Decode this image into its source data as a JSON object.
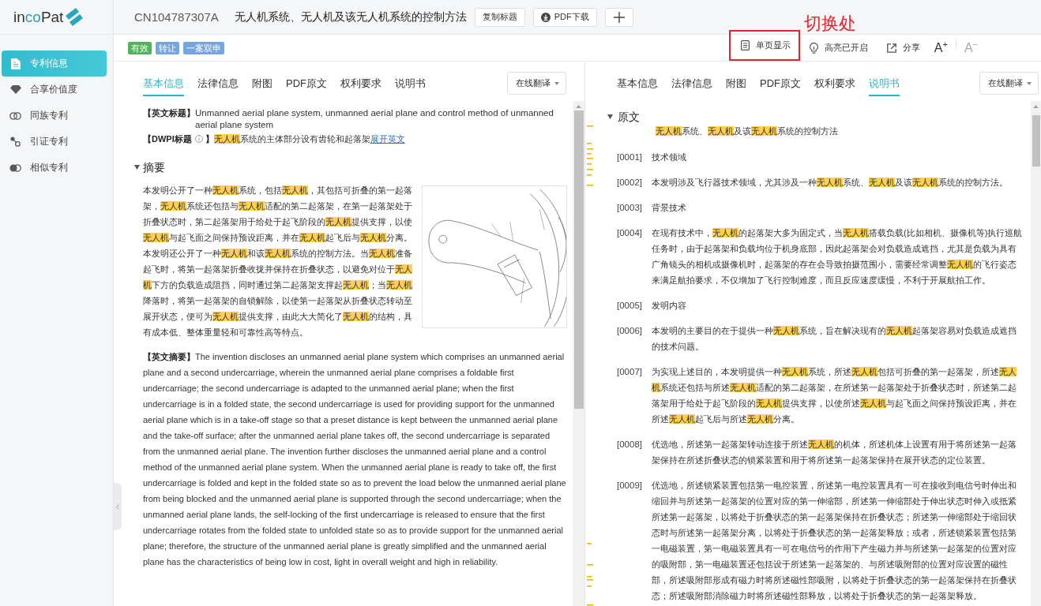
{
  "sidebar": {
    "logo": [
      {
        "text": "in",
        "accent": false
      },
      {
        "text": "co",
        "accent": true
      },
      {
        "text": "Pat",
        "accent": false
      }
    ],
    "items": [
      {
        "label": "专利信息",
        "selected": true
      },
      {
        "label": "合享价值度",
        "selected": false
      },
      {
        "label": "同族专利",
        "selected": false
      },
      {
        "label": "引证专利",
        "selected": false
      },
      {
        "label": "相似专利",
        "selected": false
      }
    ]
  },
  "header": {
    "patent_number": "CN104787307A",
    "title": "无人机系统、无人机及该无人机系统的控制方法",
    "buttons": [
      {
        "kind": "copy",
        "label": "复制标题"
      },
      {
        "kind": "download",
        "label": "PDF下载"
      },
      {
        "kind": "add"
      }
    ]
  },
  "tags": [
    {
      "label": "有效",
      "color": "#52b45a"
    },
    {
      "label": "转让",
      "color": "#76a5e0"
    },
    {
      "label": "一案双申",
      "color": "#76a5e0"
    }
  ],
  "toolbar": [
    {
      "kind": "single_page",
      "label": "单页显示",
      "annotated": true,
      "note": "切换处"
    },
    {
      "kind": "highlight",
      "label": "高亮已开启",
      "annotated": false
    },
    {
      "kind": "share",
      "label": "分享",
      "annotated": false
    },
    {
      "kind": "font_size",
      "label": "A$^{+}$",
      "disabled": false
    },
    {
      "kind": "font_size",
      "label": "A$^{−}$",
      "disabled": true
    }
  ],
  "left_panel": {
    "tabs": [
      {
        "label": "基本信息",
        "selected": true
      },
      {
        "label": "法律信息",
        "selected": false
      },
      {
        "label": "附图",
        "selected": false
      },
      {
        "label": "PDF原文",
        "selected": false
      },
      {
        "label": "权利要求",
        "selected": false
      },
      {
        "label": "说明书",
        "selected": false
      }
    ],
    "translate_button": "在线翻译",
    "english_title": {
      "label": "【英文标题】",
      "value": "Unmanned aerial plane system, unmanned aerial plane and control method of unmanned aerial plane system"
    },
    "dwpi_title": {
      "label": "【DWPI标题",
      "label_end": "】",
      "value": [
        {
          "text": "无人机",
          "highlight": true
        },
        {
          "text": "系统的主体部分设有齿轮和起落架",
          "highlight": false
        }
      ],
      "link": "展开英文"
    },
    "abstract": {
      "heading": "摘要",
      "expanded": true,
      "text": [
        {
          "text": "本发明公开了一种",
          "highlight": false
        },
        {
          "text": "无人机",
          "highlight": true
        },
        {
          "text": "系统，包括",
          "highlight": false
        },
        {
          "text": "无人机",
          "highlight": true
        },
        {
          "text": "，其包括可折叠的第一起落架，",
          "highlight": false
        },
        {
          "text": "无人机",
          "highlight": true
        },
        {
          "text": "系统还包括与",
          "highlight": false
        },
        {
          "text": "无人机",
          "highlight": true
        },
        {
          "text": "适配的第二起落架，在第一起落架处于折叠状态时，第二起落架用于给处于起飞阶段的",
          "highlight": false
        },
        {
          "text": "无人机",
          "highlight": true
        },
        {
          "text": "提供支撑，以使",
          "highlight": false
        },
        {
          "text": "无人机",
          "highlight": true
        },
        {
          "text": "与起飞面之间保持预设距离，并在",
          "highlight": false
        },
        {
          "text": "无人机",
          "highlight": true
        },
        {
          "text": "起飞后与",
          "highlight": false
        },
        {
          "text": "无人机",
          "highlight": true
        },
        {
          "text": "分离。本发明还公开了一种",
          "highlight": false
        },
        {
          "text": "无人机",
          "highlight": true
        },
        {
          "text": "和该",
          "highlight": false
        },
        {
          "text": "无人机",
          "highlight": true
        },
        {
          "text": "系统的控制方法。当",
          "highlight": false
        },
        {
          "text": "无人机",
          "highlight": true
        },
        {
          "text": "准备起飞时，将第一起落架折叠收拢并保持在折叠状态，以避免对位于",
          "highlight": false
        },
        {
          "text": "无人机",
          "highlight": true
        },
        {
          "text": "下方的负载造成阻挡，同时通过第二起落架支撑起",
          "highlight": false
        },
        {
          "text": "无人机",
          "highlight": true
        },
        {
          "text": "；当",
          "highlight": false
        },
        {
          "text": "无人机",
          "highlight": true
        },
        {
          "text": "降落时，将第一起落架的自锁解除，以使第一起落架从折叠状态转动至展开状态，便可为",
          "highlight": false
        },
        {
          "text": "无人机",
          "highlight": true
        },
        {
          "text": "提供支撑，由此大大简化了",
          "highlight": false
        },
        {
          "text": "无人机",
          "highlight": true
        },
        {
          "text": "的结构，具有成本低、整体重量轻和可靠性高等特点。",
          "highlight": false
        }
      ],
      "english_label": "【英文摘要】",
      "english_text": "The invention discloses an unmanned aerial plane system which comprises an unmanned aerial plane and a second undercarriage, wherein the unmanned aerial plane comprises a foldable first undercarriage; the second undercarriage is adapted to the unmanned aerial plane; when the first undercarriage is in a folded state, the second undercarriage is used for providing support for the unmanned aerial plane which is in a take-off stage so that a preset distance is kept between the unmanned aerial plane and the take-off surface; after the unmanned aerial plane takes off, the second undercarriage is separated from the unmanned aerial plane. The invention further discloses the unmanned aerial plane and a control method of the unmanned aerial plane system. When the unmanned aerial plane is ready to take off, the first undercarriage is folded and kept in the folded state so as to prevent the load below the unmanned aerial plane from being blocked and the unmanned aerial plane is supported through the second undercarriage; when the unmanned aerial plane lands, the self-locking of the first undercarriage is released to ensure that the first undercarriage rotates from the folded state to unfolded state so as to provide support for the unmanned aerial plane; therefore, the structure of the unmanned aerial plane is greatly simplified and the unmanned aerial plane has the characteristics of being low in cost, light in overall weight and high in reliability."
    }
  },
  "right_panel": {
    "tabs": [
      {
        "label": "基本信息",
        "selected": false
      },
      {
        "label": "法律信息",
        "selected": false
      },
      {
        "label": "附图",
        "selected": false
      },
      {
        "label": "PDF原文",
        "selected": false
      },
      {
        "label": "权利要求",
        "selected": false
      },
      {
        "label": "说明书",
        "selected": true
      }
    ],
    "translate_button": "在线翻译",
    "section": {
      "heading": "原文",
      "expanded": true,
      "title": [
        {
          "text": "无人机",
          "highlight": true
        },
        {
          "text": "系统、",
          "highlight": false
        },
        {
          "text": "无人机",
          "highlight": true
        },
        {
          "text": "及该",
          "highlight": false
        },
        {
          "text": "无人机",
          "highlight": true
        },
        {
          "text": "系统的控制方法",
          "highlight": false
        }
      ],
      "paragraphs": [
        {
          "number": "[0001]",
          "text": [
            {
              "text": "技术领域",
              "highlight": false
            }
          ]
        },
        {
          "number": "[0002]",
          "text": [
            {
              "text": "本发明涉及飞行器技术领域，尤其涉及一种",
              "highlight": false
            },
            {
              "text": "无人机",
              "highlight": true
            },
            {
              "text": "系统、",
              "highlight": false
            },
            {
              "text": "无人机",
              "highlight": true
            },
            {
              "text": "及该",
              "highlight": false
            },
            {
              "text": "无人机",
              "highlight": true
            },
            {
              "text": "系统的控制方法。",
              "highlight": false
            }
          ]
        },
        {
          "number": "[0003]",
          "text": [
            {
              "text": "背景技术",
              "highlight": false
            }
          ]
        },
        {
          "number": "[0004]",
          "text": [
            {
              "text": "在现有技术中，",
              "highlight": false
            },
            {
              "text": "无人机",
              "highlight": true
            },
            {
              "text": "的起落架大多为固定式，当",
              "highlight": false
            },
            {
              "text": "无人机",
              "highlight": true
            },
            {
              "text": "搭载负载(比如相机、摄像机等)执行巡航任务时，由于起落架和负载均位于机身底部，因此起落架会对负载造成遮挡，尤其是负载为具有广角镜头的相机或摄像机时，起落架的存在会导致拍摄范围小，需要经常调整",
              "highlight": false
            },
            {
              "text": "无人机",
              "highlight": true
            },
            {
              "text": "的飞行姿态来满足航拍要求，不仅增加了飞行控制难度，而且反应速度缓慢，不利于开展航拍工作。",
              "highlight": false
            }
          ]
        },
        {
          "number": "[0005]",
          "text": [
            {
              "text": "发明内容",
              "highlight": false
            }
          ]
        },
        {
          "number": "[0006]",
          "text": [
            {
              "text": "本发明的主要目的在于提供一种",
              "highlight": false
            },
            {
              "text": "无人机",
              "highlight": true
            },
            {
              "text": "系统，旨在解决现有的",
              "highlight": false
            },
            {
              "text": "无人机",
              "highlight": true
            },
            {
              "text": "起落架容易对负载造成遮挡的技术问题。",
              "highlight": false
            }
          ]
        },
        {
          "number": "[0007]",
          "text": [
            {
              "text": "为实现上述目的，本发明提供一种",
              "highlight": false
            },
            {
              "text": "无人机",
              "highlight": true
            },
            {
              "text": "系统，所述",
              "highlight": false
            },
            {
              "text": "无人机",
              "highlight": true
            },
            {
              "text": "包括可折叠的第一起落架，所述",
              "highlight": false
            },
            {
              "text": "无人机",
              "highlight": true
            },
            {
              "text": "系统还包括与所述",
              "highlight": false
            },
            {
              "text": "无人机",
              "highlight": true
            },
            {
              "text": "适配的第二起落架，在所述第一起落架处于折叠状态时，所述第二起落架用于给处于起飞阶段的",
              "highlight": false
            },
            {
              "text": "无人机",
              "highlight": true
            },
            {
              "text": "提供支撑，以使所述",
              "highlight": false
            },
            {
              "text": "无人机",
              "highlight": true
            },
            {
              "text": "与起飞面之间保持预设距离，并在所述",
              "highlight": false
            },
            {
              "text": "无人机",
              "highlight": true
            },
            {
              "text": "起飞后与所述",
              "highlight": false
            },
            {
              "text": "无人机",
              "highlight": true
            },
            {
              "text": "分离。",
              "highlight": false
            }
          ]
        },
        {
          "number": "[0008]",
          "text": [
            {
              "text": "优选地，所述第一起落架转动连接于所述",
              "highlight": false
            },
            {
              "text": "无人机",
              "highlight": true
            },
            {
              "text": "的机体，所述机体上设置有用于将所述第一起落架保持在所述折叠状态的锁紧装置和用于将所述第一起落架保持在展开状态的定位装置。",
              "highlight": false
            }
          ]
        },
        {
          "number": "[0009]",
          "text": [
            {
              "text": "优选地，所述锁紧装置包括第一电控装置，所述第一电控装置具有一可在接收到电信号时伸出和缩回并与所述第一起落架的位置对应的第一伸缩部，所述第一伸缩部处于伸出状态时伸入或抵紧所述第一起落架，以将处于折叠状态的第一起落架保持在折叠状态；所述第一伸缩部处于缩回状态时与所述第一起落架分离，以将处于折叠状态的第一起落架释放；或者，所述锁紧装置包括第一电磁装置，第一电磁装置具有一可在电信号的作用下产生磁力并与所述第一起落架的位置对应的吸附部，第一电磁装置还包括设于所述第一起落架的、与所述吸附部的位置对应设置的磁性部，所述吸附部形成有磁力时将所述磁性部吸附，以将处于折叠状态的第一起落架保持在折叠状态；所述吸附部消除磁力时将所述磁性部释放，以将处于折叠状态的第一起落架释放。",
              "highlight": false
            }
          ]
        }
      ]
    }
  }
}
